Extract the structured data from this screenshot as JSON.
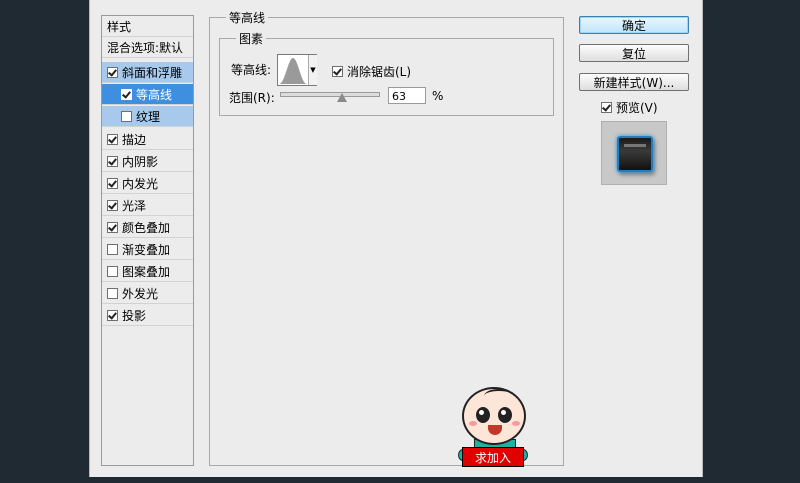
{
  "style_list": {
    "header": "样式",
    "blend_options": "混合选项:默认",
    "items": [
      {
        "label": "斜面和浮雕",
        "checked": true
      },
      {
        "label": "等高线",
        "checked": true
      },
      {
        "label": "纹理",
        "checked": false
      },
      {
        "label": "描边",
        "checked": true
      },
      {
        "label": "内阴影",
        "checked": true
      },
      {
        "label": "内发光",
        "checked": true
      },
      {
        "label": "光泽",
        "checked": true
      },
      {
        "label": "颜色叠加",
        "checked": true
      },
      {
        "label": "渐变叠加",
        "checked": false
      },
      {
        "label": "图案叠加",
        "checked": false
      },
      {
        "label": "外发光",
        "checked": false
      },
      {
        "label": "投影",
        "checked": true
      }
    ]
  },
  "panel": {
    "title": "等高线",
    "group_title": "图素",
    "contour_label": "等高线:",
    "anti_alias_label": "消除锯齿(L)",
    "anti_alias_checked": true,
    "range_label": "范围(R):",
    "range_value": "63",
    "range_unit": "%"
  },
  "buttons": {
    "ok": "确定",
    "reset": "复位",
    "new_style": "新建样式(W)...",
    "preview_label": "预览(V)",
    "preview_checked": true
  },
  "mascot": {
    "sign_text": "求加入"
  },
  "colors": {
    "selection_strong": "#3f8fe0",
    "selection_light": "#a6c9ec",
    "preview_glow": "#2a94d8",
    "sign_red": "#e00000"
  }
}
